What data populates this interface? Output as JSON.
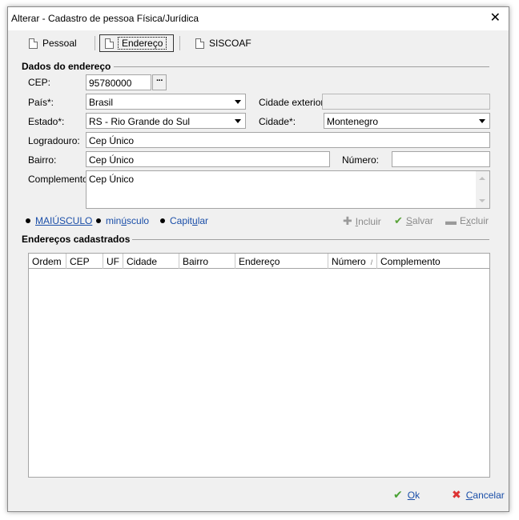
{
  "window": {
    "title": "Alterar - Cadastro de pessoa Física/Jurídica",
    "close_glyph": "✕"
  },
  "tabs": [
    {
      "label": "Pessoal",
      "active": false
    },
    {
      "label": "Endereço",
      "active": true
    },
    {
      "label": "SISCOAF",
      "active": false
    }
  ],
  "address": {
    "section_title": "Dados do endereço",
    "cep_label": "CEP:",
    "cep_value": "95780000",
    "cep_button": "···",
    "pais_label": "País*:",
    "pais_value": "Brasil",
    "cidade_exterior_label": "Cidade exterior:",
    "cidade_exterior_value": "",
    "estado_label": "Estado*:",
    "estado_value": "RS - Rio Grande do Sul",
    "cidade_label": "Cidade*:",
    "cidade_value": "Montenegro",
    "logradouro_label": "Logradouro:",
    "logradouro_value": "Cep Único",
    "bairro_label": "Bairro:",
    "bairro_value": "Cep Único",
    "numero_label": "Número:",
    "numero_value": "",
    "complemento_label": "Complemento:",
    "complemento_value": "Cep Único"
  },
  "case_options": [
    {
      "pre": "MAIÚSCULO",
      "ul": "",
      "post": ""
    },
    {
      "pre": "min",
      "ul": "ú",
      "post": "sculo"
    },
    {
      "pre": "Capit",
      "ul": "u",
      "post": "lar"
    }
  ],
  "actions": {
    "incluir": {
      "pre": "",
      "ul": "I",
      "post": "ncluir"
    },
    "salvar": {
      "pre": "",
      "ul": "S",
      "post": "alvar"
    },
    "excluir": {
      "pre": "E",
      "ul": "x",
      "post": "cluir"
    }
  },
  "list": {
    "section_title": "Endereços cadastrados",
    "columns": [
      "Ordem",
      "CEP",
      "UF",
      "Cidade",
      "Bairro",
      "Endereço",
      "Número",
      "Complemento"
    ],
    "sorted_column": "Número",
    "sort_glyph": "/",
    "rows": []
  },
  "footer": {
    "ok": {
      "pre": "",
      "ul": "O",
      "post": "k"
    },
    "cancelar": {
      "pre": "",
      "ul": "C",
      "post": "ancelar"
    }
  },
  "icons": {
    "tab_icon": "document-icon",
    "incluir": "plus-icon",
    "salvar": "check-icon",
    "excluir": "minus-icon",
    "ok": "check-icon",
    "cancelar": "x-icon"
  },
  "colors": {
    "link": "#1a4ea8",
    "ok_green": "#4aa234",
    "cancel_red": "#dd3333"
  }
}
